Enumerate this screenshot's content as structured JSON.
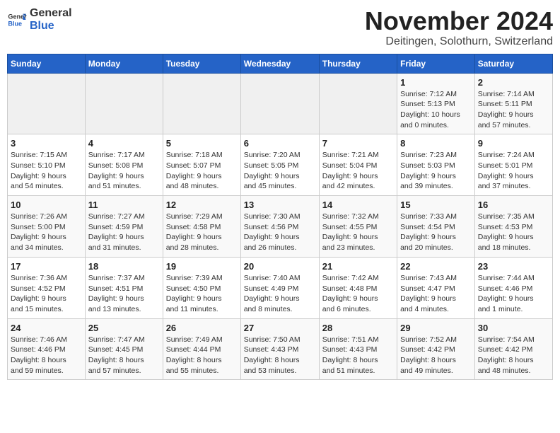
{
  "logo": {
    "text_general": "General",
    "text_blue": "Blue"
  },
  "title": "November 2024",
  "subtitle": "Deitingen, Solothurn, Switzerland",
  "days_of_week": [
    "Sunday",
    "Monday",
    "Tuesday",
    "Wednesday",
    "Thursday",
    "Friday",
    "Saturday"
  ],
  "weeks": [
    [
      {
        "day": "",
        "info": ""
      },
      {
        "day": "",
        "info": ""
      },
      {
        "day": "",
        "info": ""
      },
      {
        "day": "",
        "info": ""
      },
      {
        "day": "",
        "info": ""
      },
      {
        "day": "1",
        "info": "Sunrise: 7:12 AM\nSunset: 5:13 PM\nDaylight: 10 hours\nand 0 minutes."
      },
      {
        "day": "2",
        "info": "Sunrise: 7:14 AM\nSunset: 5:11 PM\nDaylight: 9 hours\nand 57 minutes."
      }
    ],
    [
      {
        "day": "3",
        "info": "Sunrise: 7:15 AM\nSunset: 5:10 PM\nDaylight: 9 hours\nand 54 minutes."
      },
      {
        "day": "4",
        "info": "Sunrise: 7:17 AM\nSunset: 5:08 PM\nDaylight: 9 hours\nand 51 minutes."
      },
      {
        "day": "5",
        "info": "Sunrise: 7:18 AM\nSunset: 5:07 PM\nDaylight: 9 hours\nand 48 minutes."
      },
      {
        "day": "6",
        "info": "Sunrise: 7:20 AM\nSunset: 5:05 PM\nDaylight: 9 hours\nand 45 minutes."
      },
      {
        "day": "7",
        "info": "Sunrise: 7:21 AM\nSunset: 5:04 PM\nDaylight: 9 hours\nand 42 minutes."
      },
      {
        "day": "8",
        "info": "Sunrise: 7:23 AM\nSunset: 5:03 PM\nDaylight: 9 hours\nand 39 minutes."
      },
      {
        "day": "9",
        "info": "Sunrise: 7:24 AM\nSunset: 5:01 PM\nDaylight: 9 hours\nand 37 minutes."
      }
    ],
    [
      {
        "day": "10",
        "info": "Sunrise: 7:26 AM\nSunset: 5:00 PM\nDaylight: 9 hours\nand 34 minutes."
      },
      {
        "day": "11",
        "info": "Sunrise: 7:27 AM\nSunset: 4:59 PM\nDaylight: 9 hours\nand 31 minutes."
      },
      {
        "day": "12",
        "info": "Sunrise: 7:29 AM\nSunset: 4:58 PM\nDaylight: 9 hours\nand 28 minutes."
      },
      {
        "day": "13",
        "info": "Sunrise: 7:30 AM\nSunset: 4:56 PM\nDaylight: 9 hours\nand 26 minutes."
      },
      {
        "day": "14",
        "info": "Sunrise: 7:32 AM\nSunset: 4:55 PM\nDaylight: 9 hours\nand 23 minutes."
      },
      {
        "day": "15",
        "info": "Sunrise: 7:33 AM\nSunset: 4:54 PM\nDaylight: 9 hours\nand 20 minutes."
      },
      {
        "day": "16",
        "info": "Sunrise: 7:35 AM\nSunset: 4:53 PM\nDaylight: 9 hours\nand 18 minutes."
      }
    ],
    [
      {
        "day": "17",
        "info": "Sunrise: 7:36 AM\nSunset: 4:52 PM\nDaylight: 9 hours\nand 15 minutes."
      },
      {
        "day": "18",
        "info": "Sunrise: 7:37 AM\nSunset: 4:51 PM\nDaylight: 9 hours\nand 13 minutes."
      },
      {
        "day": "19",
        "info": "Sunrise: 7:39 AM\nSunset: 4:50 PM\nDaylight: 9 hours\nand 11 minutes."
      },
      {
        "day": "20",
        "info": "Sunrise: 7:40 AM\nSunset: 4:49 PM\nDaylight: 9 hours\nand 8 minutes."
      },
      {
        "day": "21",
        "info": "Sunrise: 7:42 AM\nSunset: 4:48 PM\nDaylight: 9 hours\nand 6 minutes."
      },
      {
        "day": "22",
        "info": "Sunrise: 7:43 AM\nSunset: 4:47 PM\nDaylight: 9 hours\nand 4 minutes."
      },
      {
        "day": "23",
        "info": "Sunrise: 7:44 AM\nSunset: 4:46 PM\nDaylight: 9 hours\nand 1 minute."
      }
    ],
    [
      {
        "day": "24",
        "info": "Sunrise: 7:46 AM\nSunset: 4:46 PM\nDaylight: 8 hours\nand 59 minutes."
      },
      {
        "day": "25",
        "info": "Sunrise: 7:47 AM\nSunset: 4:45 PM\nDaylight: 8 hours\nand 57 minutes."
      },
      {
        "day": "26",
        "info": "Sunrise: 7:49 AM\nSunset: 4:44 PM\nDaylight: 8 hours\nand 55 minutes."
      },
      {
        "day": "27",
        "info": "Sunrise: 7:50 AM\nSunset: 4:43 PM\nDaylight: 8 hours\nand 53 minutes."
      },
      {
        "day": "28",
        "info": "Sunrise: 7:51 AM\nSunset: 4:43 PM\nDaylight: 8 hours\nand 51 minutes."
      },
      {
        "day": "29",
        "info": "Sunrise: 7:52 AM\nSunset: 4:42 PM\nDaylight: 8 hours\nand 49 minutes."
      },
      {
        "day": "30",
        "info": "Sunrise: 7:54 AM\nSunset: 4:42 PM\nDaylight: 8 hours\nand 48 minutes."
      }
    ]
  ]
}
